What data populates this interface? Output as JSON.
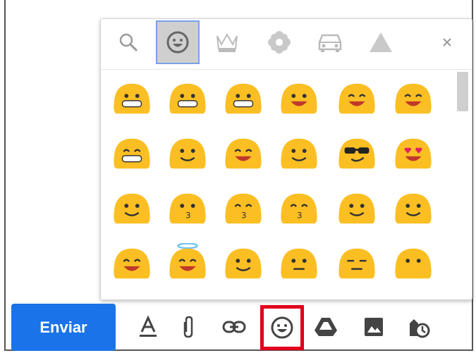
{
  "colors": {
    "accent": "#1a73e8",
    "highlight": "#e0001b",
    "emoji_face": "#fbbf24",
    "mouth": "#c0392b"
  },
  "picker": {
    "tabs": [
      {
        "icon": "search-icon"
      },
      {
        "icon": "smiley-icon",
        "active": true
      },
      {
        "icon": "crown-icon"
      },
      {
        "icon": "flower-icon"
      },
      {
        "icon": "car-icon"
      },
      {
        "icon": "triangle-icon"
      }
    ],
    "close_icon": "close-icon"
  },
  "emojis": [
    [
      "grinning",
      "grin-teeth",
      "laugh-tears",
      "smile-open",
      "smile-blush",
      "sweat-smile"
    ],
    [
      "laughing",
      "wink",
      "relieved",
      "yum",
      "sunglasses",
      "heart-eyes"
    ],
    [
      "kiss-wink",
      "kissing",
      "kiss-smile",
      "kiss-closed",
      "slight-smile",
      "slight-smile-2"
    ],
    [
      "hug",
      "halo",
      "thinking",
      "neutral",
      "expressionless",
      "no-mouth"
    ]
  ],
  "toolbar": {
    "send_label": "Enviar",
    "tools": [
      "format-text-icon",
      "attach-icon",
      "link-icon",
      "emoji-icon",
      "drive-icon",
      "photo-icon",
      "schedule-icon"
    ]
  }
}
